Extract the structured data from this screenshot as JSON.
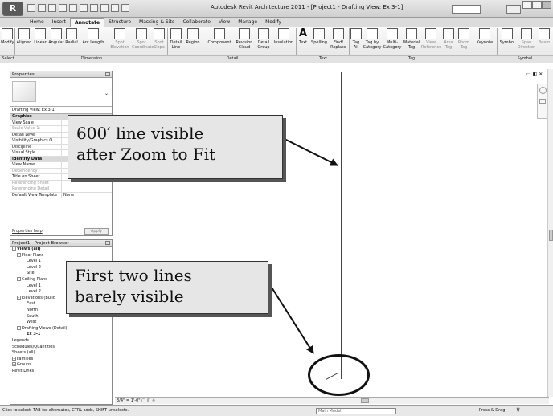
{
  "window": {
    "logo": "R",
    "title": "Autodesk Revit Architecture 2011 - [Project1 - Drafting View: Ex 3-1]"
  },
  "tabs": [
    "Home",
    "Insert",
    "Annotate",
    "Structure",
    "Massing & Site",
    "Collaborate",
    "View",
    "Manage",
    "Modify"
  ],
  "active_tab": "Annotate",
  "ribbon": {
    "tools": [
      {
        "label": "Modify",
        "icon": "cursor-icon"
      },
      {
        "label": "Aligned",
        "icon": "aligned-dimension-icon"
      },
      {
        "label": "Linear",
        "icon": "linear-dimension-icon"
      },
      {
        "label": "Angular",
        "icon": "angular-dimension-icon"
      },
      {
        "label": "Radial",
        "icon": "radial-dimension-icon"
      },
      {
        "label": "Arc Length",
        "icon": "arc-length-icon"
      },
      {
        "label": "Spot Elevation",
        "icon": "spot-elevation-icon"
      },
      {
        "label": "Spot Coordinate",
        "icon": "spot-coordinate-icon"
      },
      {
        "label": "Spot Slope",
        "icon": "spot-slope-icon"
      },
      {
        "label": "Detail Line",
        "icon": "detail-line-icon"
      },
      {
        "label": "Region",
        "icon": "region-icon"
      },
      {
        "label": "Component",
        "icon": "component-icon"
      },
      {
        "label": "Revision Cloud",
        "icon": "revision-cloud-icon"
      },
      {
        "label": "Detail Group",
        "icon": "detail-group-icon"
      },
      {
        "label": "Insulation",
        "icon": "insulation-icon"
      },
      {
        "label": "Text",
        "icon": "text-icon"
      },
      {
        "label": "Spelling",
        "icon": "spelling-icon"
      },
      {
        "label": "Find/ Replace",
        "icon": "find-replace-icon"
      },
      {
        "label": "Tag All",
        "icon": "tag-all-icon"
      },
      {
        "label": "Tag by Category",
        "icon": "tag-by-category-icon"
      },
      {
        "label": "Multi- Category",
        "icon": "multi-category-icon"
      },
      {
        "label": "Material Tag",
        "icon": "material-tag-icon"
      },
      {
        "label": "View Reference",
        "icon": "view-reference-icon"
      },
      {
        "label": "Area Tag",
        "icon": "area-tag-icon"
      },
      {
        "label": "Room Tag",
        "icon": "room-tag-icon"
      },
      {
        "label": "Keynote",
        "icon": "keynote-icon"
      },
      {
        "label": "Symbol",
        "icon": "symbol-icon"
      },
      {
        "label": "Span Direction",
        "icon": "span-direction-icon"
      },
      {
        "label": "Beam",
        "icon": "beam-icon"
      }
    ],
    "panels": [
      "Select",
      "Dimension",
      "Detail",
      "Text",
      "Tag",
      "Symbol"
    ]
  },
  "properties": {
    "title": "Properties",
    "filter": "Drafting View: Ex 3-1",
    "rows": [
      {
        "k": "Graphics",
        "v": "",
        "group": true
      },
      {
        "k": "View Scale",
        "v": ""
      },
      {
        "k": "Scale Value   1:",
        "v": "",
        "dim": true
      },
      {
        "k": "Detail Level",
        "v": ""
      },
      {
        "k": "Visibility/Graphics O...",
        "v": ""
      },
      {
        "k": "Discipline",
        "v": ""
      },
      {
        "k": "Visual Style",
        "v": ""
      },
      {
        "k": "Identity Data",
        "v": "",
        "group": true
      },
      {
        "k": "View Name",
        "v": ""
      },
      {
        "k": "Dependency",
        "v": "",
        "dim": true
      },
      {
        "k": "Title on Sheet",
        "v": ""
      },
      {
        "k": "Referencing Sheet",
        "v": "",
        "dim": true
      },
      {
        "k": "Referencing Detail",
        "v": "",
        "dim": true
      },
      {
        "k": "Default View Template",
        "v": "None"
      }
    ],
    "help_link": "Properties help",
    "apply": "Apply"
  },
  "browser": {
    "title": "Project1 - Project Browser",
    "items": [
      {
        "label": "Views (all)",
        "indent": 0,
        "twist": "-",
        "bold": true
      },
      {
        "label": "Floor Plans",
        "indent": 1,
        "twist": "-"
      },
      {
        "label": "Level 1",
        "indent": 3
      },
      {
        "label": "Level 2",
        "indent": 3
      },
      {
        "label": "Site",
        "indent": 3
      },
      {
        "label": "Ceiling Plans",
        "indent": 1,
        "twist": "-"
      },
      {
        "label": "Level 1",
        "indent": 3
      },
      {
        "label": "Level 2",
        "indent": 3
      },
      {
        "label": "Elevations (Build",
        "indent": 1,
        "twist": "-"
      },
      {
        "label": "East",
        "indent": 3
      },
      {
        "label": "North",
        "indent": 3
      },
      {
        "label": "South",
        "indent": 3
      },
      {
        "label": "West",
        "indent": 3
      },
      {
        "label": "Drafting Views (Detail)",
        "indent": 1,
        "twist": "-"
      },
      {
        "label": "Ex 3-1",
        "indent": 3,
        "bold": true
      },
      {
        "label": "Legends",
        "indent": 0
      },
      {
        "label": "Schedules/Quantities",
        "indent": 0
      },
      {
        "label": "Sheets (all)",
        "indent": 0
      },
      {
        "label": "Families",
        "indent": 0,
        "twist": "+"
      },
      {
        "label": "Groups",
        "indent": 0,
        "twist": "+"
      },
      {
        "label": "Revit Links",
        "indent": 0
      }
    ]
  },
  "callouts": {
    "top_line1": "600′ line visible",
    "top_line2": "after Zoom to Fit",
    "bottom_line1": "First two lines",
    "bottom_line2": "barely visible"
  },
  "view_bar": {
    "scale": "3/4\" = 1'-0\""
  },
  "status": {
    "text": "Click to select, TAB for alternates, CTRL adds, SHIFT unselects.",
    "workset": "Main Model",
    "press_drag": "Press & Drag"
  }
}
